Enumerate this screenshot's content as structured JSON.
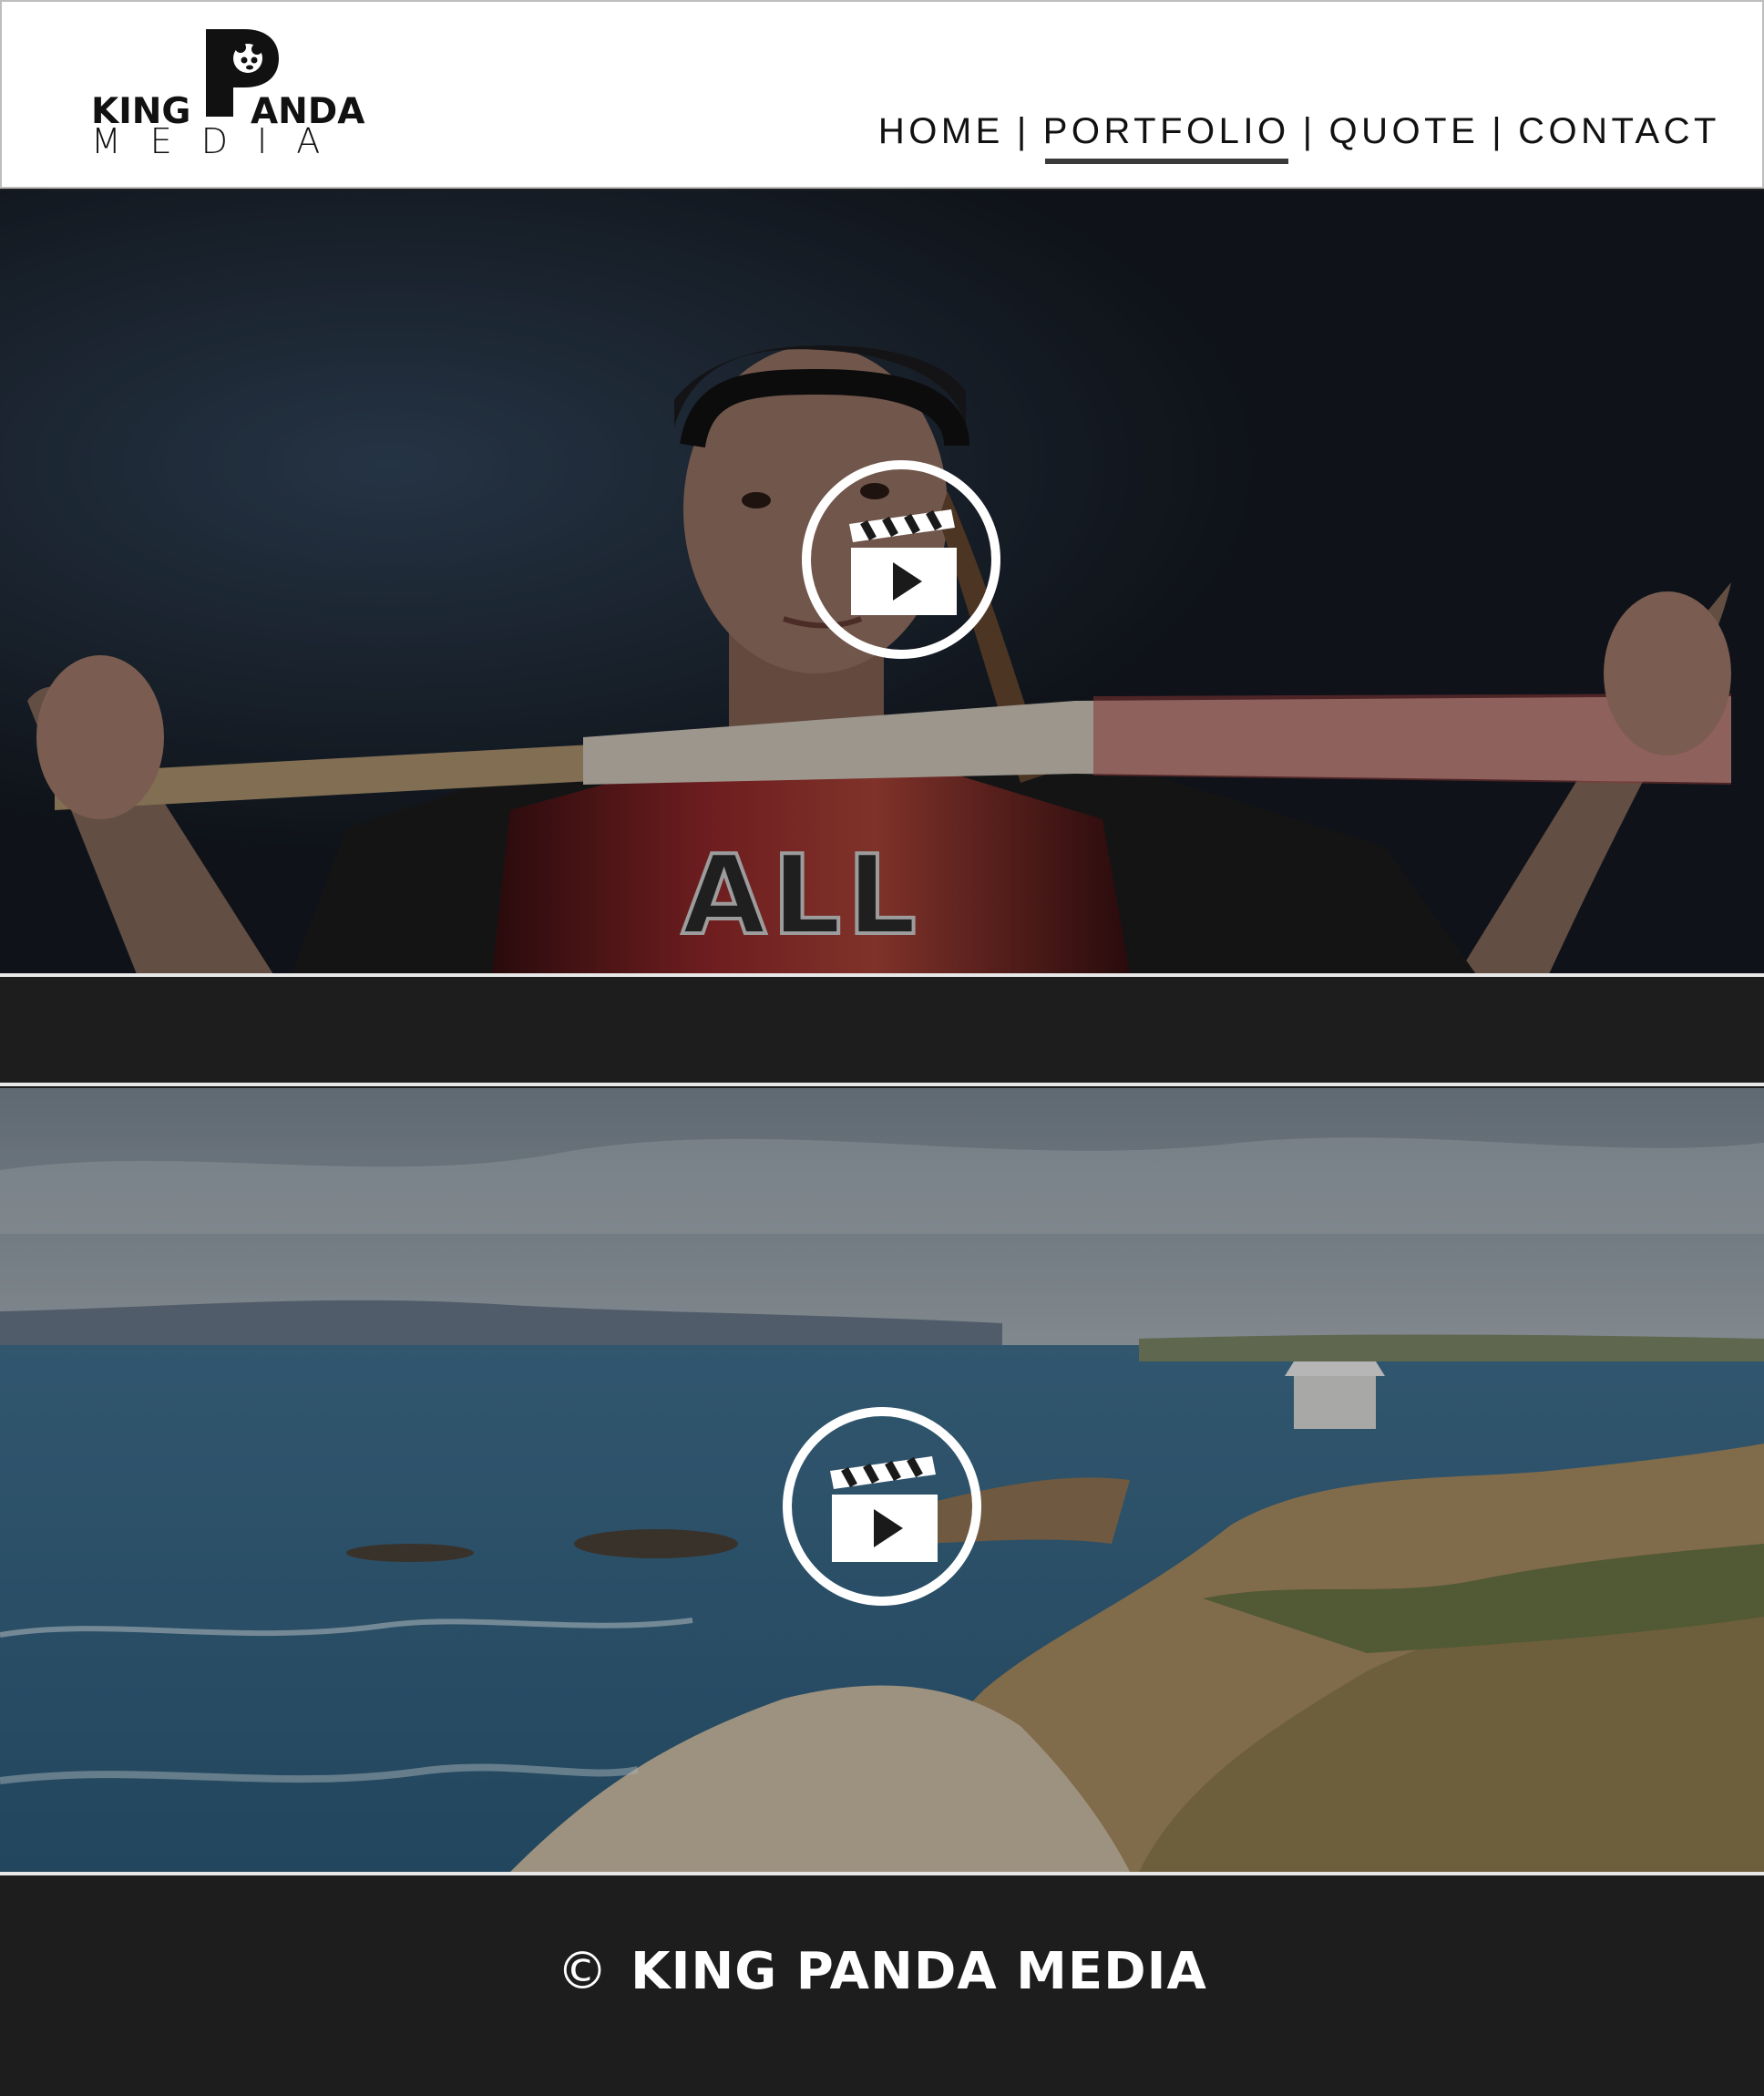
{
  "header": {
    "logo": {
      "line1_left": "KING",
      "line1_right": "ANDA",
      "line2": "MEDIA",
      "mark_icon": "panda-p-icon"
    },
    "nav": {
      "items": [
        {
          "label": "HOME",
          "active": false
        },
        {
          "label": "PORTFOLIO",
          "active": true
        },
        {
          "label": "QUOTE",
          "active": false
        },
        {
          "label": "CONTACT",
          "active": false
        }
      ],
      "separator": "|"
    }
  },
  "media": [
    {
      "subject": "Softball player holding a bat behind her shoulders",
      "overlay_icon": "clapperboard-play-icon"
    },
    {
      "subject": "Coastal beach with cliffs and ocean",
      "overlay_icon": "clapperboard-play-icon"
    }
  ],
  "footer": {
    "copyright_symbol": "©",
    "text": "KING PANDA MEDIA"
  },
  "colors": {
    "header_bg": "#ffffff",
    "page_bg": "#1d1d1d",
    "text_dark": "#111111",
    "text_light": "#ffffff"
  }
}
